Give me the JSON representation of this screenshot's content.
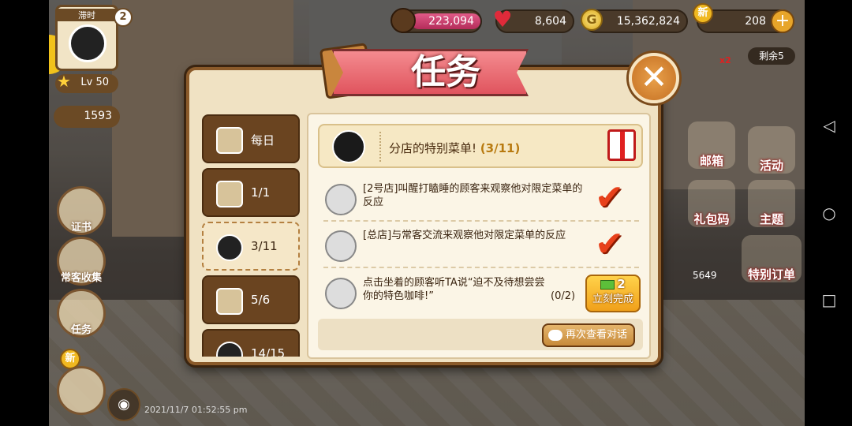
{
  "hud": {
    "coffee": "223,094",
    "hearts": "8,604",
    "gold": "15,362,824",
    "gold_symbol": "G",
    "gems": "208",
    "gem_plus": "+",
    "new_badge": "新",
    "remaining": "剩余5",
    "x_badge": "x2"
  },
  "player": {
    "name": "滞时",
    "level": "Lv 50",
    "coins": "1593",
    "badge_count": "2"
  },
  "left_menu": {
    "certificate": "证书",
    "collection": "常客收集",
    "tasks": "任务",
    "new_badge": "新"
  },
  "right_menu": {
    "mailbox": "邮箱",
    "activity": "活动",
    "giftcode": "礼包码",
    "theme": "主题",
    "special_order": "特别订单",
    "special_count": "5649"
  },
  "timestamp": "2021/11/7 01:52:55 pm",
  "modal": {
    "title": "任务",
    "close_symbol": "✕",
    "tabs": [
      {
        "label": "每日",
        "active": false
      },
      {
        "label": "1/1",
        "active": false
      },
      {
        "label": "3/11",
        "active": true
      },
      {
        "label": "5/6",
        "active": false
      },
      {
        "label": "14/15",
        "active": false
      }
    ],
    "quest": {
      "title": "分店的特别菜单!",
      "progress": "(3/11)"
    },
    "tasks": [
      {
        "text": "[2号店]叫醒打瞌睡的顾客来观察他对限定菜单的反应",
        "done": true
      },
      {
        "text": "[总店]与常客交流来观察他对限定菜单的反应",
        "done": true
      },
      {
        "text": "点击坐着的顾客听TA说“迫不及待想尝尝你的特色咖啡!”",
        "done": false,
        "count": "(0/2)",
        "cost": "2",
        "button": "立刻完成"
      }
    ],
    "check_symbol": "✔",
    "review_button": "再次查看对话"
  },
  "system_nav": {
    "back": "◁",
    "home": "○",
    "recent": "□"
  }
}
